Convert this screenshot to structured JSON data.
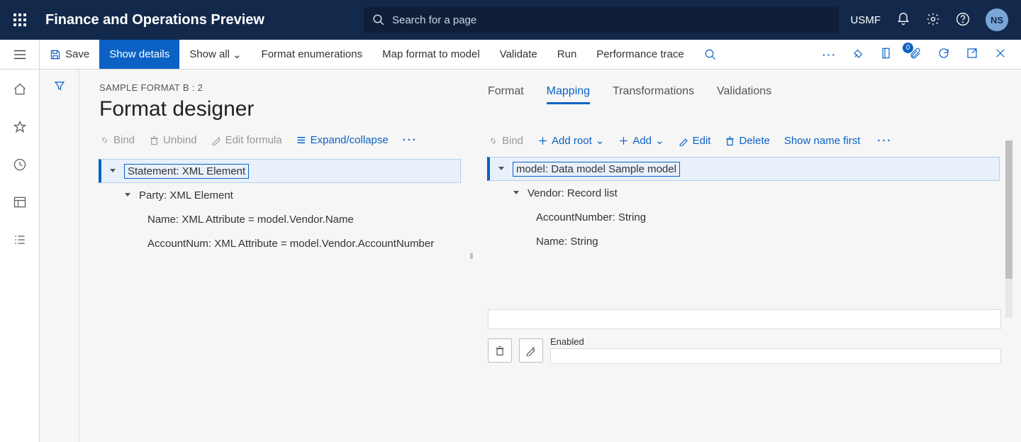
{
  "header": {
    "app_title": "Finance and Operations Preview",
    "search_placeholder": "Search for a page",
    "environment": "USMF",
    "avatar_initials": "NS"
  },
  "commandbar": {
    "save": "Save",
    "show_details": "Show details",
    "show_all": "Show all",
    "format_enumerations": "Format enumerations",
    "map_format_to_model": "Map format to model",
    "validate": "Validate",
    "run": "Run",
    "performance_trace": "Performance trace",
    "badge_count": "0"
  },
  "page": {
    "breadcrumb": "SAMPLE FORMAT B : 2",
    "title": "Format designer"
  },
  "format_toolbar": {
    "bind": "Bind",
    "unbind": "Unbind",
    "edit_formula": "Edit formula",
    "expand_collapse": "Expand/collapse"
  },
  "format_tree": {
    "root": "Statement: XML Element",
    "party": "Party: XML Element",
    "name_attr": "Name: XML Attribute = model.Vendor.Name",
    "account_attr": "AccountNum: XML Attribute = model.Vendor.AccountNumber"
  },
  "tabs": {
    "format": "Format",
    "mapping": "Mapping",
    "transformations": "Transformations",
    "validations": "Validations"
  },
  "mapping_toolbar": {
    "bind": "Bind",
    "add_root": "Add root",
    "add": "Add",
    "edit": "Edit",
    "delete": "Delete",
    "show_name_first": "Show name first"
  },
  "mapping_tree": {
    "root": "model: Data model Sample model",
    "vendor": "Vendor: Record list",
    "account_number": "AccountNumber: String",
    "name": "Name: String"
  },
  "bottom": {
    "enabled_label": "Enabled"
  }
}
